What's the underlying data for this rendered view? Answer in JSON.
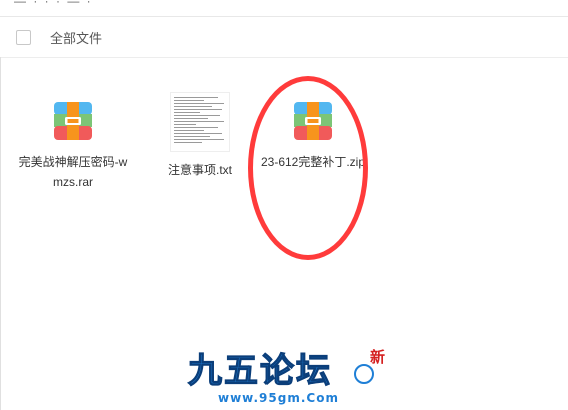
{
  "header": {
    "label": "全部文件"
  },
  "files": [
    {
      "name": "完美战神解压密码-wmzs.rar",
      "icon": "archive-icon"
    },
    {
      "name": "注意事项.txt",
      "icon": "text-file-thumbnail"
    },
    {
      "name": "23-612完整补丁.zip",
      "icon": "archive-icon"
    }
  ],
  "watermark": {
    "logo_text": "九五论坛",
    "url": "www.95gm.Com",
    "badge": "新"
  },
  "colors": {
    "annotation_red": "#ff3b3b",
    "archive_top": "#52b7f0",
    "archive_mid": "#7cc576",
    "archive_bottom": "#f15a5a",
    "archive_band": "#f7941d"
  }
}
